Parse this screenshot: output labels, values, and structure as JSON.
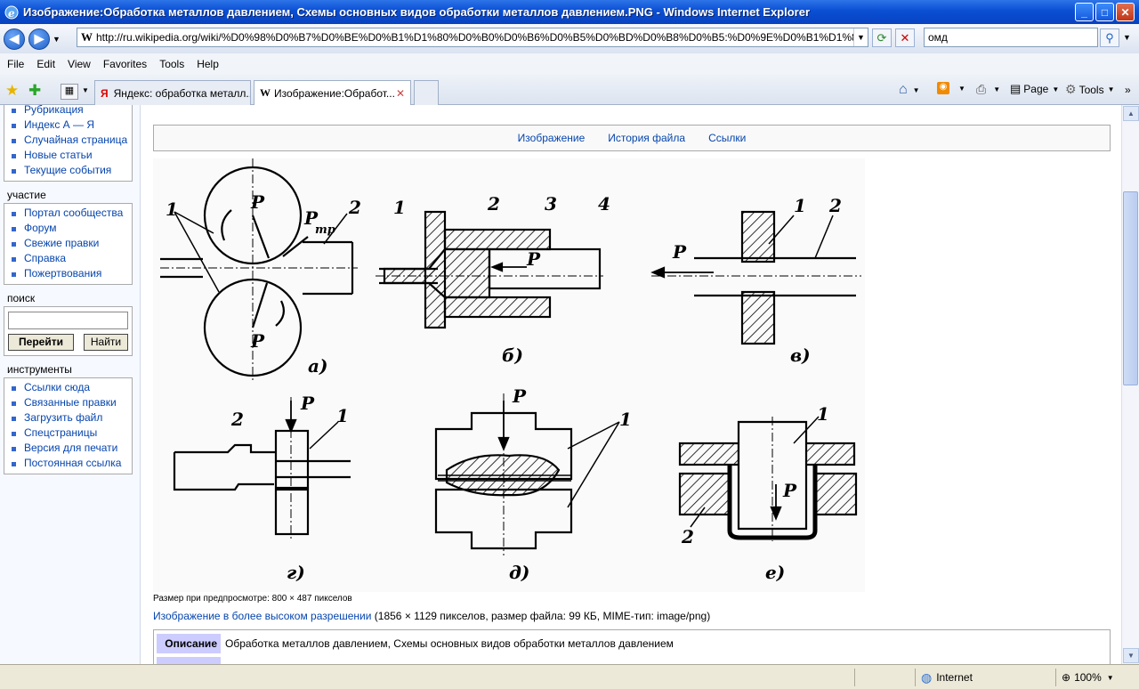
{
  "window": {
    "title": "Изображение:Обработка металлов давлением, Схемы основных видов обработки металлов давлением.PNG - Windows Internet Explorer",
    "min": "_",
    "max": "□",
    "close": "✕"
  },
  "address": {
    "url": "http://ru.wikipedia.org/wiki/%D0%98%D0%B7%D0%BE%D0%B1%D1%80%D0%B0%D0%B6%D0%B5%D0%BD%D0%B8%D0%B5:%D0%9E%D0%B1%D1%80%D0%B0%D0%B1",
    "search_value": "омд"
  },
  "menu": [
    "File",
    "Edit",
    "View",
    "Favorites",
    "Tools",
    "Help"
  ],
  "tabs": [
    {
      "label": "Яндекс: обработка металл..."
    },
    {
      "label": "Изображение:Обработ..."
    }
  ],
  "commands": {
    "page": "Page",
    "tools": "Tools"
  },
  "sidebar": {
    "nav_items": [
      "Рубрикация",
      "Индекс А — Я",
      "Случайная страница",
      "Новые статьи",
      "Текущие события"
    ],
    "participation_heading": "участие",
    "participation_items": [
      "Портал сообщества",
      "Форум",
      "Свежие правки",
      "Справка",
      "Пожертвования"
    ],
    "search_heading": "поиск",
    "go_button": "Перейти",
    "find_button": "Найти",
    "tools_heading": "инструменты",
    "tools_items": [
      "Ссылки сюда",
      "Связанные правки",
      "Загрузить файл",
      "Спецстраницы",
      "Версия для печати",
      "Постоянная ссылка"
    ]
  },
  "content": {
    "tabs": [
      "Изображение",
      "История файла",
      "Ссылки"
    ],
    "preview_note": "Размер при предпросмотре: 800 × 487 пикселов",
    "hires_link": "Изображение в более высоком разрешении",
    "hires_info": " (1856 × 1129 пикселов, размер файла: 99 КБ, MIME-тип: image/png)",
    "desc_label": "Описание",
    "desc_text": "Обработка металлов давлением, Схемы основных видов обработки металлов давлением"
  },
  "figure": {
    "labels": {
      "a": "а)",
      "b": "б)",
      "v": "в)",
      "g": "г)",
      "d": "д)",
      "e": "е)",
      "P": "P",
      "Ptr": "P",
      "tr": "тр",
      "n1": "1",
      "n2": "2",
      "n3": "3",
      "n4": "4"
    }
  },
  "status": {
    "zone": "Internet",
    "zoom": "100%"
  }
}
